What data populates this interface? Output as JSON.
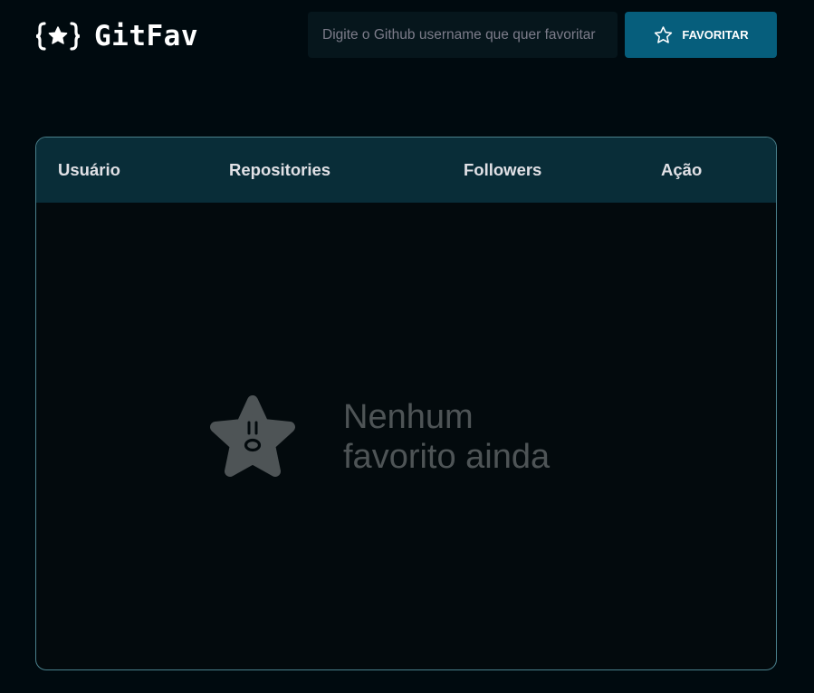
{
  "header": {
    "logo_text": "GitFav",
    "logo_icon": "braces-star-icon",
    "search": {
      "value": "",
      "placeholder": "Digite o Github username que quer favoritar"
    },
    "favorite_button_label": "FAVORITAR",
    "favorite_button_icon": "star-outline-icon"
  },
  "table": {
    "columns": [
      "Usuário",
      "Repositories",
      "Followers",
      "Ação"
    ],
    "rows": []
  },
  "empty_state": {
    "icon": "surprised-star-icon",
    "line1": "Nenhum",
    "line2": "favorito ainda"
  },
  "colors": {
    "background": "#000a0f",
    "accent_button": "#065e7c",
    "table_header": "#092d38",
    "panel_border": "#4a808c",
    "empty_text": "#4e5456"
  }
}
